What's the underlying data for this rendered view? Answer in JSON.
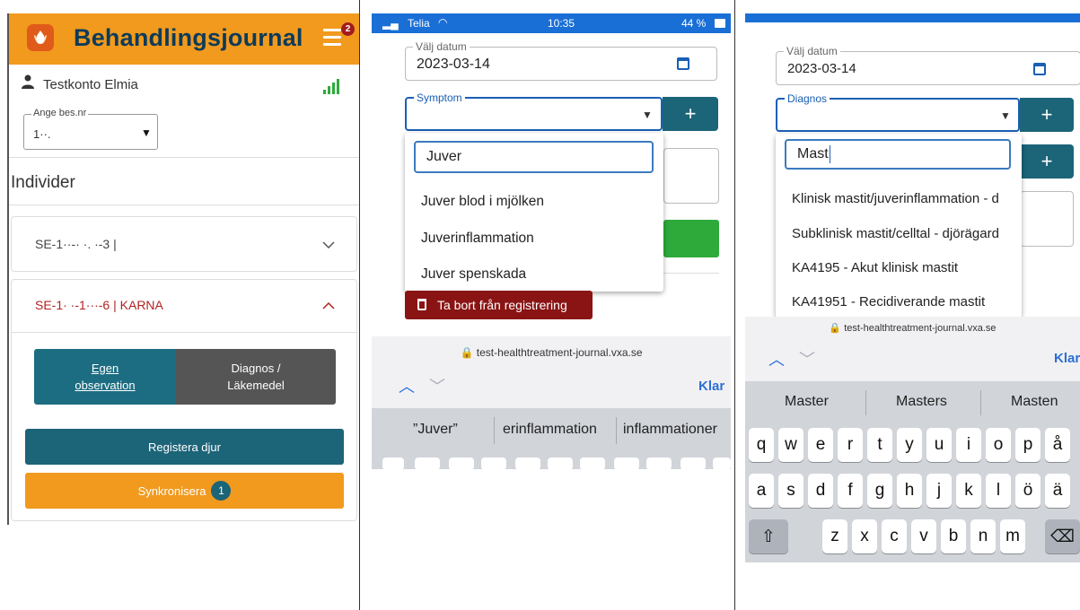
{
  "panel1": {
    "app_title": "Behandlingsjournal",
    "menu_badge": "2",
    "user_name": "Testkonto Elmia",
    "besnr_label": "Ange bes.nr",
    "besnr_value": "1··.",
    "section_title": "Individer",
    "individuals": [
      {
        "label": "SE-1··-· ·. ·-3 |"
      },
      {
        "label": "SE-1· ·-1···-6 | KARNA"
      }
    ],
    "tab_own_observation": "Egen observation",
    "tab_diagnosis_medicine": "Diagnos / Läkemedel",
    "register_button": "Registera djur",
    "sync_button": "Synkronisera",
    "sync_count": "1",
    "colors": {
      "header": "#f19a1e",
      "primary": "#1c6478",
      "title": "#0d3b5a",
      "active_individual": "#b22222",
      "signal": "#2eaa3b"
    }
  },
  "panel2": {
    "status": {
      "carrier": "Telia",
      "time": "10:35",
      "battery": "44 %"
    },
    "date_label": "Välj datum",
    "date_value": "2023-03-14",
    "symptom_label": "Symptom",
    "search_value": "Juver",
    "options": [
      "Juver blod i mjölken",
      "Juverinflammation",
      "Juver spenskada"
    ],
    "delete_button": "Ta bort från registrering",
    "url": "test-healthtreatment-journal.vxa.se",
    "done_label": "Klar",
    "suggestions": [
      "”Juver”",
      "erinflammation",
      "inflammationer"
    ],
    "colors": {
      "status_bar": "#1a6fd6",
      "delete": "#8a1414",
      "search_border": "#3a7bbf",
      "add": "#1c6478",
      "confirm": "#2eaa3b"
    }
  },
  "panel3": {
    "date_label": "Välj datum",
    "date_value": "2023-03-14",
    "diagnosis_label": "Diagnos",
    "search_value": "Mast",
    "options": [
      "Klinisk mastit/juverinflammation - d",
      "Subklinisk mastit/celltal - djörägard",
      "KA4195 - Akut klinisk mastit",
      "KA41951 - Recidiverande mastit"
    ],
    "url": "test-healthtreatment-journal.vxa.se",
    "done_label": "Klar",
    "suggestions": [
      "Master",
      "Masters",
      "Masten"
    ],
    "keyboard_rows": [
      [
        "q",
        "w",
        "e",
        "r",
        "t",
        "y",
        "u",
        "i",
        "o",
        "p",
        "å"
      ],
      [
        "a",
        "s",
        "d",
        "f",
        "g",
        "h",
        "j",
        "k",
        "l",
        "ö",
        "ä"
      ],
      [
        "z",
        "x",
        "c",
        "v",
        "b",
        "n",
        "m"
      ]
    ]
  }
}
